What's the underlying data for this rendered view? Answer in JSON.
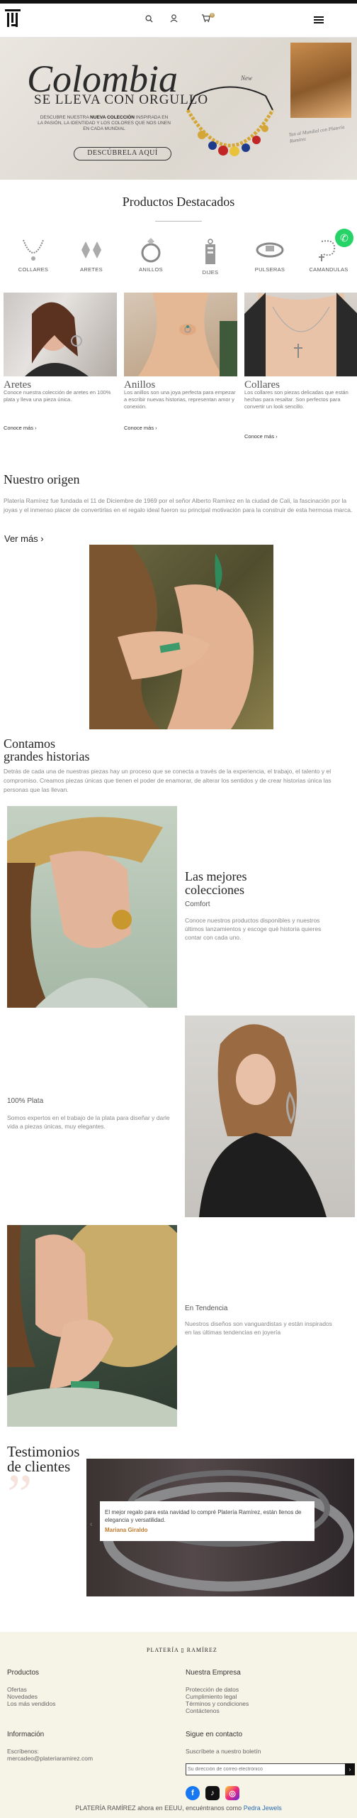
{
  "colors": {
    "accent": "#c2a15c",
    "testimonial_name": "#c07a2e",
    "footer_bg": "#f6f3e7",
    "whatsapp": "#25d366"
  },
  "header": {
    "icons": [
      "logo-icon",
      "search-icon",
      "user-icon",
      "cart-icon",
      "menu-icon"
    ],
    "cart_count": "0"
  },
  "hero": {
    "title": "Colombia",
    "subtitle": "SE LLEVA CON ORGULLO",
    "desc_pre": "DESCUBRE NUESTRA",
    "desc_bold": "NUEVA COLECCIÓN",
    "desc_post": "INSPIRADA EN LA PASIÓN, LA IDENTIDAD Y LOS COLORES QUE NOS UNEN EN CADA MUNDIAL",
    "button": "DESCÚBRELA AQUÍ",
    "script_label": "New",
    "note": "Tan al Mundial con Platería Ramírez"
  },
  "featured": {
    "title": "Productos Destacados",
    "categories": [
      "COLLARES",
      "ARETES",
      "ANILLOS",
      "DIJES",
      "PULSERAS",
      "CAMANDULAS"
    ],
    "products": [
      {
        "title": "Aretes",
        "desc": "Conoce nuestra colección de aretes en 100% plata y lleva una pieza única.",
        "link": "Conoce más ›"
      },
      {
        "title": "Anillos",
        "desc": "Los anillos son una joya perfecta para empezar a escribir nuevas historias, representan amor y conexión.",
        "link": "Conoce más ›"
      },
      {
        "title": "Collares",
        "desc": "Los collares son piezas delicadas que están hechas para resaltar. Son perfectos para convertir un look sencillo.",
        "link": "Conoce más ›"
      }
    ]
  },
  "origin": {
    "title": "Nuestro origen",
    "text": "Platería Ramírez fue fundada el 11 de Diciembre de 1969 por el señor Alberto Ramírez en la ciudad de Cali, la fascinación por la joyas y el inmenso placer de convertirlas en el regalo ideal fueron su principal motivación para la construir de esta hermosa marca.",
    "link": "Ver más ›"
  },
  "stories": {
    "title_line1": "Contamos",
    "title_line2": "grandes historias",
    "text": "Detrás de cada una de nuestras piezas hay un proceso que se conecta a través de la experiencia, el trabajo, el talento y el compromiso. Creamos piezas únicas que tienen el poder de enamorar, de alterar los sentidos y de crear historias única las personas que las llevan."
  },
  "features": [
    {
      "title_line1": "Las mejores",
      "title_line2": "colecciones",
      "sub": "Comfort",
      "desc": "Conoce nuestros productos disponibles y nuestros últimos lanzamientos y escoge qué historia quieres contar con cada uno."
    },
    {
      "sub": "100% Plata",
      "desc": "Somos expertos en el trabajo de la plata para diseñar y darle vida a piezas únicas, muy elegantes."
    },
    {
      "sub": "En Tendencia",
      "desc": "Nuestros diseños son vanguardistas y están inspirados en las últimas tendencias en joyería"
    }
  ],
  "testimonials": {
    "title_line1": "Testimonios",
    "title_line2": "de clientes",
    "quote": "El mejor regalo para esta navidad lo compré Platería Ramírez, están llenos de elegancia y versatilidad.",
    "author": "Mariana Giraldo"
  },
  "footer": {
    "logo": "PLATERÍA ▯ RAMÍREZ",
    "col1_title": "Productos",
    "col1_items": [
      "Ofertas",
      "Novedades",
      "Los más vendidos"
    ],
    "col2_title": "Nuestra Empresa",
    "col2_items": [
      "Protección de datos",
      "Cumplimiento legal",
      "Términos y condiciones",
      "Contáctenos"
    ],
    "info_title": "Información",
    "info_label": "Escríbenos:",
    "info_email": "mercadeo@plateriaramirez.com",
    "contact_title": "Sigue en contacto",
    "newsletter_label": "Suscríbete a nuestro boletín",
    "newsletter_placeholder": "Su dirección de correo electrónico",
    "social": [
      "facebook-icon",
      "tiktok-icon",
      "instagram-icon"
    ],
    "bottom_pre": "PLATERÍA RAMÍREZ ahora en EEUU, encuéntranos como",
    "bottom_link": "Pedra Jewels"
  }
}
